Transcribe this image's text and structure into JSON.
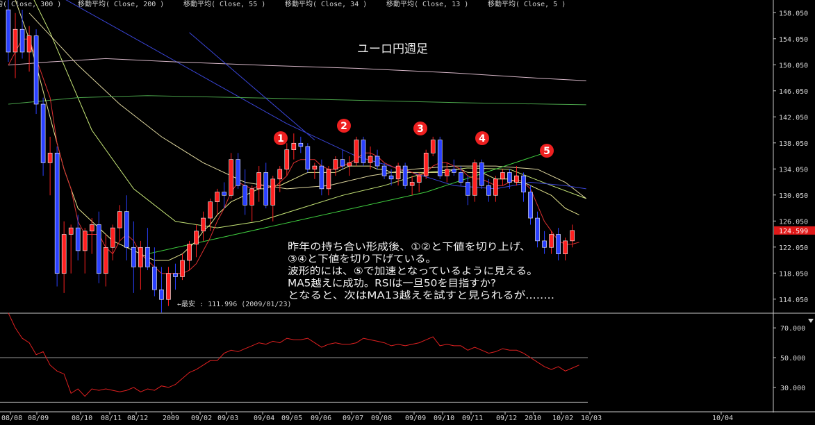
{
  "chart_data": [
    {
      "type": "candlestick",
      "title": "ユーロ円週足",
      "legend": [
        "均( Close, 300 )",
        "移動平均( Close, 200 )",
        "移動平均( Close, 55 )",
        "移動平均( Close, 34 )",
        "移動平均( Close, 13 )",
        "移動平均( Close, 5 )"
      ],
      "ylim": [
        112.0,
        160.0
      ],
      "yticks": [
        "158.050",
        "154.050",
        "150.050",
        "146.050",
        "142.050",
        "138.050",
        "134.050",
        "130.050",
        "126.050",
        "122.050",
        "118.050",
        "114.050"
      ],
      "ytick_values": [
        158.05,
        154.05,
        150.05,
        146.05,
        142.05,
        138.05,
        134.05,
        130.05,
        126.05,
        122.05,
        118.05,
        114.05
      ],
      "current_price": "124.599",
      "low_annotation": "←最安 : 111.996 (2009/01/23)",
      "wave_labels": [
        "1",
        "2",
        "3",
        "4",
        "5"
      ],
      "commentary": [
        "昨年の持ち合い形成後、①②と下値を切り上げ、",
        "③④と下値を切り下げている。",
        "波形的には、⑤で加速となっているように見える。",
        "MA5越えに成功。RSIは一旦50を目指すか?",
        "となると、次はMA13越えを試すと見られるが........"
      ],
      "candles": [
        [
          158.5,
          160.0,
          150.5,
          152.0
        ],
        [
          152.0,
          158.0,
          148.0,
          155.5
        ],
        [
          155.5,
          158.5,
          151.0,
          152.0
        ],
        [
          152.0,
          156.0,
          149.0,
          154.5
        ],
        [
          154.5,
          155.5,
          142.5,
          144.0
        ],
        [
          144.0,
          145.0,
          133.0,
          135.0
        ],
        [
          135.0,
          139.0,
          130.0,
          136.5
        ],
        [
          136.5,
          137.5,
          116.0,
          118.0
        ],
        [
          118.0,
          126.0,
          115.0,
          124.0
        ],
        [
          124.0,
          125.5,
          118.0,
          125.0
        ],
        [
          125.0,
          127.0,
          120.0,
          121.5
        ],
        [
          121.5,
          125.0,
          118.0,
          124.5
        ],
        [
          124.5,
          126.5,
          121.0,
          125.5
        ],
        [
          125.5,
          127.5,
          116.5,
          118.0
        ],
        [
          118.0,
          124.0,
          116.0,
          122.0
        ],
        [
          122.0,
          125.5,
          120.0,
          125.0
        ],
        [
          125.0,
          128.5,
          123.0,
          127.5
        ],
        [
          127.5,
          130.0,
          120.0,
          122.0
        ],
        [
          122.0,
          126.0,
          115.0,
          119.0
        ],
        [
          119.0,
          123.0,
          115.5,
          122.0
        ],
        [
          122.0,
          125.0,
          118.5,
          119.0
        ],
        [
          119.0,
          122.0,
          114.5,
          115.5
        ],
        [
          115.5,
          119.0,
          112.0,
          114.0
        ],
        [
          114.0,
          119.0,
          113.0,
          118.0
        ],
        [
          118.0,
          119.5,
          115.5,
          117.5
        ],
        [
          117.5,
          121.0,
          117.0,
          120.0
        ],
        [
          120.0,
          123.0,
          118.5,
          122.5
        ],
        [
          122.5,
          125.5,
          120.5,
          124.5
        ],
        [
          124.5,
          127.5,
          123.0,
          126.5
        ],
        [
          126.5,
          129.5,
          124.5,
          129.0
        ],
        [
          129.0,
          131.0,
          127.0,
          130.5
        ],
        [
          130.5,
          132.0,
          128.0,
          130.0
        ],
        [
          130.0,
          136.5,
          129.5,
          135.5
        ],
        [
          135.5,
          136.5,
          131.0,
          131.5
        ],
        [
          131.5,
          134.0,
          127.0,
          128.5
        ],
        [
          128.5,
          131.5,
          126.0,
          131.0
        ],
        [
          131.0,
          134.5,
          129.0,
          133.5
        ],
        [
          133.5,
          135.0,
          128.0,
          128.5
        ],
        [
          128.5,
          133.0,
          126.0,
          132.5
        ],
        [
          132.5,
          134.5,
          130.5,
          134.0
        ],
        [
          134.0,
          138.0,
          133.0,
          137.0
        ],
        [
          137.0,
          139.5,
          135.5,
          138.0
        ],
        [
          138.0,
          139.0,
          136.5,
          137.5
        ],
        [
          137.5,
          138.0,
          133.5,
          134.0
        ],
        [
          134.0,
          135.0,
          132.5,
          134.5
        ],
        [
          134.5,
          135.5,
          130.0,
          131.0
        ],
        [
          131.0,
          134.5,
          130.0,
          134.0
        ],
        [
          134.0,
          136.0,
          133.0,
          135.5
        ],
        [
          135.5,
          137.0,
          134.0,
          134.5
        ],
        [
          134.5,
          136.0,
          133.0,
          135.0
        ],
        [
          135.0,
          139.0,
          134.5,
          138.5
        ],
        [
          138.5,
          139.0,
          134.5,
          135.0
        ],
        [
          135.0,
          137.5,
          134.0,
          136.0
        ],
        [
          136.0,
          137.0,
          134.0,
          134.5
        ],
        [
          134.5,
          135.0,
          132.5,
          133.0
        ],
        [
          133.0,
          134.0,
          131.5,
          132.5
        ],
        [
          132.5,
          135.0,
          131.5,
          134.5
        ],
        [
          134.5,
          135.0,
          131.0,
          131.5
        ],
        [
          131.5,
          133.0,
          130.0,
          132.0
        ],
        [
          132.0,
          133.5,
          130.5,
          133.0
        ],
        [
          133.0,
          137.0,
          132.5,
          136.5
        ],
        [
          136.5,
          139.0,
          136.0,
          138.5
        ],
        [
          138.5,
          139.0,
          132.5,
          133.0
        ],
        [
          133.0,
          135.0,
          132.0,
          134.0
        ],
        [
          134.0,
          135.5,
          133.0,
          133.5
        ],
        [
          133.5,
          134.5,
          131.5,
          132.0
        ],
        [
          132.0,
          133.0,
          128.5,
          130.0
        ],
        [
          130.0,
          135.5,
          129.0,
          135.0
        ],
        [
          135.0,
          135.5,
          131.0,
          131.5
        ],
        [
          131.5,
          132.5,
          129.0,
          130.0
        ],
        [
          130.0,
          133.0,
          129.0,
          132.5
        ],
        [
          132.5,
          134.0,
          131.5,
          133.5
        ],
        [
          133.5,
          134.0,
          131.0,
          132.0
        ],
        [
          132.0,
          134.5,
          131.5,
          133.0
        ],
        [
          133.0,
          133.5,
          129.0,
          130.5
        ],
        [
          130.5,
          131.5,
          125.5,
          126.5
        ],
        [
          126.5,
          127.5,
          122.0,
          123.0
        ],
        [
          123.0,
          124.5,
          121.0,
          122.0
        ],
        [
          122.0,
          124.5,
          121.0,
          124.0
        ],
        [
          124.0,
          125.0,
          120.0,
          121.0
        ],
        [
          121.0,
          123.5,
          120.0,
          123.0
        ],
        [
          123.0,
          125.5,
          122.0,
          124.6
        ]
      ],
      "rsi_ylim": [
        15,
        78
      ],
      "rsi_yticks": [
        "70.000",
        "50.000",
        "30.000"
      ],
      "rsi_ytick_values": [
        70,
        50,
        30
      ],
      "rsi_guides": [
        50,
        20
      ],
      "rsi": [
        80,
        70,
        63,
        60,
        52,
        54,
        45,
        41,
        39,
        26,
        29,
        24,
        29,
        28,
        29,
        28,
        27,
        28,
        30,
        27,
        29,
        28,
        31,
        30,
        32,
        36,
        40,
        42,
        45,
        48,
        48,
        53,
        55,
        54,
        56,
        58,
        60,
        59,
        61,
        60,
        63,
        62,
        62,
        63,
        60,
        57,
        59,
        60,
        59,
        59,
        60,
        63,
        62,
        61,
        60,
        58,
        59,
        58,
        59,
        60,
        62,
        64,
        58,
        59,
        58,
        58,
        55,
        57,
        55,
        53,
        54,
        56,
        55,
        55,
        53,
        50,
        47,
        44,
        42,
        44,
        41,
        43,
        45
      ],
      "ma5": [
        150,
        152,
        154,
        154,
        151,
        148,
        145,
        138,
        134,
        131,
        126,
        124,
        124,
        124,
        122,
        121,
        123,
        124,
        123,
        121,
        120,
        119,
        118,
        118,
        118,
        118,
        118.5,
        119.5,
        121.5,
        123.5,
        126,
        128,
        130.5,
        132,
        131.5,
        131,
        131.5,
        131.5,
        131,
        132,
        133,
        135,
        135.5,
        135.5,
        135.5,
        134.5,
        134,
        134,
        134.5,
        135,
        135.5,
        136.5,
        136.5,
        136,
        135,
        134.5,
        134,
        134,
        133.5,
        133,
        133.5,
        134.5,
        135,
        135,
        134.5,
        134,
        133,
        132.5,
        132.5,
        132,
        131.5,
        131.5,
        132,
        132.5,
        132,
        131,
        128.5,
        126,
        124.5,
        123,
        122.5,
        122.5,
        122.8
      ],
      "ma13": [
        162,
        160,
        157,
        154,
        150,
        146,
        142,
        138,
        134,
        131,
        128,
        127,
        126,
        125,
        124,
        123,
        122.5,
        122,
        121.5,
        121,
        120.5,
        120,
        120,
        120,
        120.5,
        121,
        122,
        123,
        124.5,
        125.5,
        127,
        128,
        129,
        129.5,
        130,
        130.5,
        131,
        131,
        131.5,
        131.5,
        132,
        132.5,
        133,
        133.5,
        133.5,
        133.5,
        133.5,
        133.5,
        134,
        134.5,
        134.5,
        134.5,
        134.5,
        134,
        134,
        133.5,
        133.5,
        133.5,
        133.5,
        133.5,
        133.5,
        133.5,
        133.5,
        133.5,
        134,
        134,
        133.5,
        133.5,
        133.5,
        133,
        132.5,
        132.5,
        132.5,
        132,
        132,
        131.5,
        131,
        130.5,
        130,
        129,
        128,
        127.5,
        127
      ],
      "ma_lines": [
        {
          "name": "MA34",
          "color": "#c8e878",
          "points": [
            [
              0,
              168
            ],
            [
              6,
              155
            ],
            [
              12,
              140
            ],
            [
              18,
              131
            ],
            [
              24,
              126
            ],
            [
              30,
              125
            ],
            [
              36,
              126
            ],
            [
              42,
              128
            ],
            [
              48,
              130
            ],
            [
              54,
              131.5
            ],
            [
              60,
              133.5
            ],
            [
              66,
              134.2
            ],
            [
              72,
              134
            ],
            [
              78,
              131.5
            ],
            [
              83,
              129.5
            ]
          ]
        },
        {
          "name": "MA55",
          "color": "#e0d8a0",
          "points": [
            [
              3,
              158
            ],
            [
              10,
              150
            ],
            [
              16,
              144
            ],
            [
              22,
              139
            ],
            [
              28,
              135
            ],
            [
              34,
              132
            ],
            [
              40,
              131
            ],
            [
              46,
              131.5
            ],
            [
              52,
              133
            ],
            [
              58,
              134
            ],
            [
              64,
              134.5
            ],
            [
              70,
              134.5
            ],
            [
              76,
              134
            ],
            [
              80,
              132
            ],
            [
              83,
              129.5
            ]
          ]
        },
        {
          "name": "MA200",
          "color": "#3a45d8",
          "points": [
            [
              0,
              165
            ],
            [
              10,
              159
            ],
            [
              20,
              153
            ],
            [
              30,
              147
            ],
            [
              40,
              141
            ],
            [
              50,
              136
            ],
            [
              58,
              133.5
            ],
            [
              64,
              131.5
            ],
            [
              70,
              131
            ],
            [
              75,
              132
            ],
            [
              80,
              131.5
            ],
            [
              83,
              131
            ]
          ]
        },
        {
          "name": "MA300",
          "color": "#d7b7c8",
          "points": [
            [
              0,
              150
            ],
            [
              6,
              150.5
            ],
            [
              14,
              151
            ],
            [
              24,
              150.5
            ],
            [
              36,
              150
            ],
            [
              50,
              149.5
            ],
            [
              64,
              148.8
            ],
            [
              76,
              148
            ],
            [
              83,
              147.6
            ]
          ]
        },
        {
          "name": "MA(long)",
          "color": "#4aa34a",
          "points": [
            [
              0,
              144
            ],
            [
              10,
              145
            ],
            [
              20,
              145.3
            ],
            [
              34,
              145
            ],
            [
              50,
              144.6
            ],
            [
              66,
              144.2
            ],
            [
              83,
              143.9
            ]
          ]
        }
      ],
      "trendlines": [
        {
          "color": "#40d040",
          "points": [
            [
              20,
              121
            ],
            [
              60,
              130.5
            ],
            [
              77,
              136.5
            ]
          ]
        },
        {
          "color": "#3a45d8",
          "points": [
            [
              26,
              155
            ],
            [
              44,
              138.5
            ]
          ]
        }
      ],
      "xticks": [
        "08/08",
        "08/09",
        "08/10",
        "08/11",
        "08/12",
        "2009",
        "09/02",
        "09/03",
        "09/04",
        "09/05",
        "09/06",
        "09/07",
        "09/08",
        "09/09",
        "09/10",
        "09/11",
        "09/12",
        "2010",
        "10/02",
        "10/03",
        "10/04"
      ],
      "x_clipped_left": "7"
    }
  ]
}
